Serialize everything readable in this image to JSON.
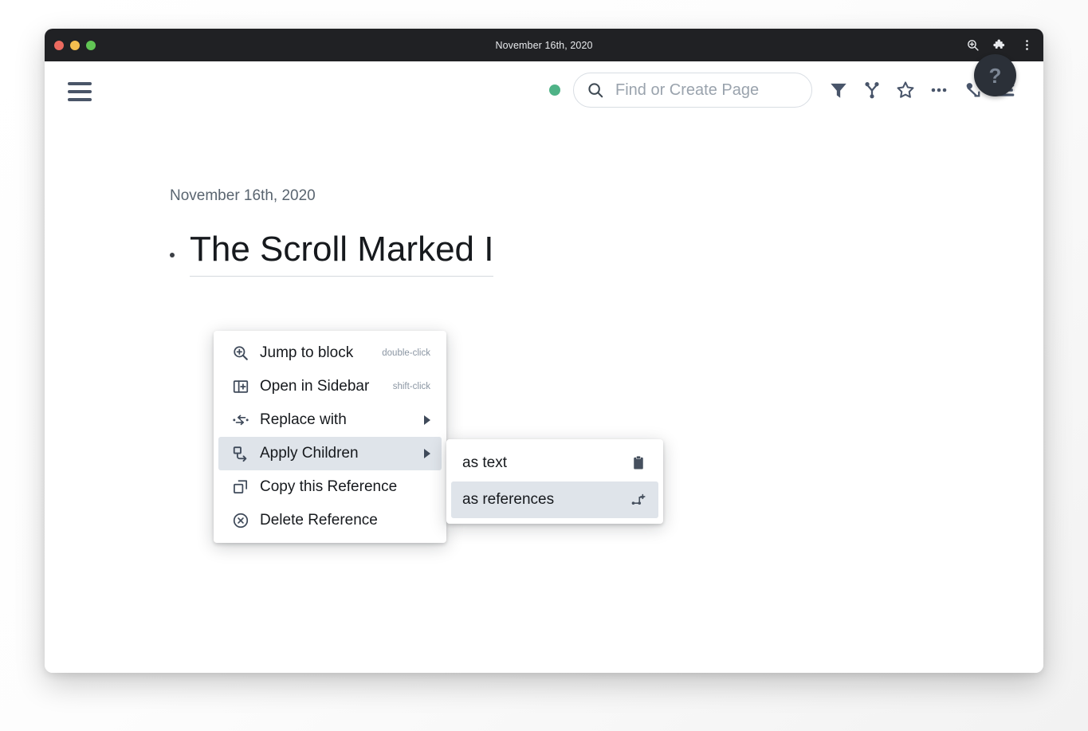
{
  "window": {
    "titlebar": {
      "title": "November 16th, 2020",
      "traffic_lights": [
        "close",
        "minimize",
        "maximize"
      ],
      "actions": [
        {
          "name": "zoom-in-icon",
          "label": "Zoom"
        },
        {
          "name": "puzzle-piece-icon",
          "label": "Extensions"
        },
        {
          "name": "more-vertical-icon",
          "label": "Menu"
        }
      ]
    }
  },
  "topbar": {
    "menu_button": {
      "name": "hamburger-icon",
      "label": "Menu"
    },
    "status_dot_color": "#4fb387",
    "search": {
      "placeholder": "Find or Create Page",
      "value": "",
      "icon": "search-icon"
    },
    "tools": [
      {
        "name": "filter-icon",
        "label": "Filter"
      },
      {
        "name": "graph-icon",
        "label": "Graph Overview"
      },
      {
        "name": "star-icon",
        "label": "Favorite"
      },
      {
        "name": "more-horizontal-icon",
        "label": "More Options"
      },
      {
        "name": "person-arrow-icon",
        "label": "Share"
      },
      {
        "name": "right-sidebar-icon",
        "label": "Toggle Right Sidebar"
      }
    ]
  },
  "content": {
    "page_date": "November 16th, 2020",
    "block": {
      "bullet": "•",
      "reference_text": "The Scroll Marked I"
    }
  },
  "context_menu": {
    "items": [
      {
        "icon": "zoom-in-icon",
        "label": "Jump to block",
        "hint": "double-click",
        "has_submenu": false,
        "active": false
      },
      {
        "icon": "open-sidebar-icon",
        "label": "Open in Sidebar",
        "hint": "shift-click",
        "has_submenu": false,
        "active": false
      },
      {
        "icon": "swap-arrows-icon",
        "label": "Replace with",
        "hint": "",
        "has_submenu": true,
        "active": false
      },
      {
        "icon": "apply-children-icon",
        "label": "Apply Children",
        "hint": "",
        "has_submenu": true,
        "active": true
      },
      {
        "icon": "copy-icon",
        "label": "Copy this Reference",
        "hint": "",
        "has_submenu": false,
        "active": false
      },
      {
        "icon": "delete-circle-icon",
        "label": "Delete Reference",
        "hint": "",
        "has_submenu": false,
        "active": false
      }
    ],
    "highlight_color": "#dfe4ea"
  },
  "submenu": {
    "items": [
      {
        "label": "as text",
        "trail_icon": "clipboard-icon",
        "active": false
      },
      {
        "label": "as references",
        "trail_icon": "node-plus-icon",
        "active": true
      }
    ]
  },
  "help": {
    "label": "?",
    "name": "help-button"
  }
}
